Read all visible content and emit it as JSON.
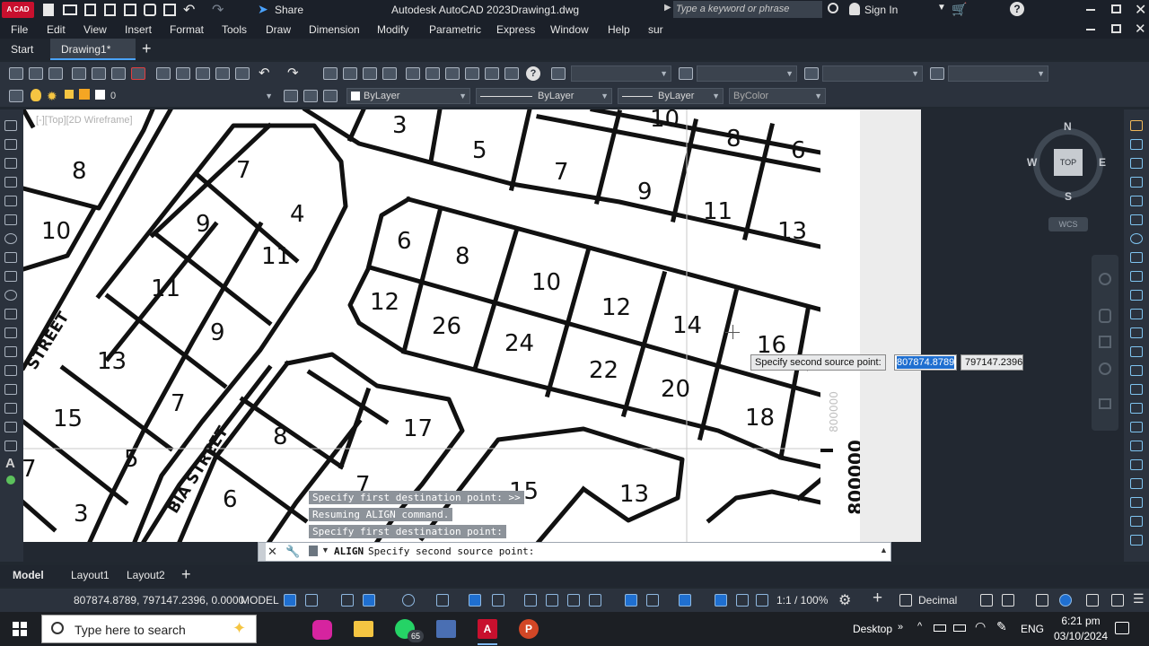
{
  "title_bar": {
    "app_badge": "A CAD",
    "share_label": "Share",
    "app_title": "Autodesk AutoCAD 2023",
    "file_name": "Drawing1.dwg",
    "search_placeholder": "Type a keyword or phrase",
    "sign_in": "Sign In"
  },
  "menu": [
    "File",
    "Edit",
    "View",
    "Insert",
    "Format",
    "Tools",
    "Draw",
    "Dimension",
    "Modify",
    "Parametric",
    "Express",
    "Window",
    "Help",
    "sur"
  ],
  "file_tabs": {
    "start": "Start",
    "active": "Drawing1*",
    "add": "+"
  },
  "layer_toolbar": {
    "layer_value": "0",
    "color": "ByLayer",
    "linetype": "ByLayer",
    "lineweight": "ByLayer",
    "plotstyle": "ByColor"
  },
  "viewport_label": "[-][Top][2D Wireframe]",
  "viewcube": {
    "n": "N",
    "s": "S",
    "e": "E",
    "w": "W",
    "top": "TOP",
    "wcs": "WCS"
  },
  "map": {
    "lots": [
      "3",
      "5",
      "7",
      "9",
      "11",
      "13",
      "10",
      "8",
      "6",
      "8",
      "10",
      "7",
      "4",
      "9",
      "11",
      "6",
      "8",
      "10",
      "12",
      "14",
      "16",
      "12",
      "26",
      "24",
      "22",
      "20",
      "18",
      "11",
      "9",
      "13",
      "7",
      "15",
      "5",
      "17",
      "8",
      "3",
      "6",
      "7",
      "15",
      "13",
      "7",
      "9",
      "11",
      "13"
    ],
    "street_labels": [
      "STREET",
      "BIA STREET"
    ],
    "coordinate_label": "800000"
  },
  "dynamic_input": {
    "prompt": "Specify second source point:",
    "x_value": "807874.8789",
    "y_value": "797147.2396"
  },
  "command_history": [
    "Specify first destination point: >>",
    "Resuming ALIGN command.",
    "Specify first destination point:"
  ],
  "command_line": {
    "command": "ALIGN",
    "prompt": "Specify second source point:"
  },
  "layout_tabs": [
    "Model",
    "Layout1",
    "Layout2"
  ],
  "status": {
    "coords": "807874.8789, 797147.2396, 0.0000",
    "space": "MODEL",
    "scale": "1:1 / 100%",
    "units": "Decimal"
  },
  "taskbar": {
    "search_placeholder": "Type here to search",
    "whatsapp_badge": "65",
    "desktop": "Desktop",
    "lang": "ENG",
    "time": "6:21 pm",
    "date": "03/10/2024"
  },
  "colors": {
    "accent": "#c8102e",
    "selection": "#1f6fd0",
    "bg": "#212830"
  }
}
